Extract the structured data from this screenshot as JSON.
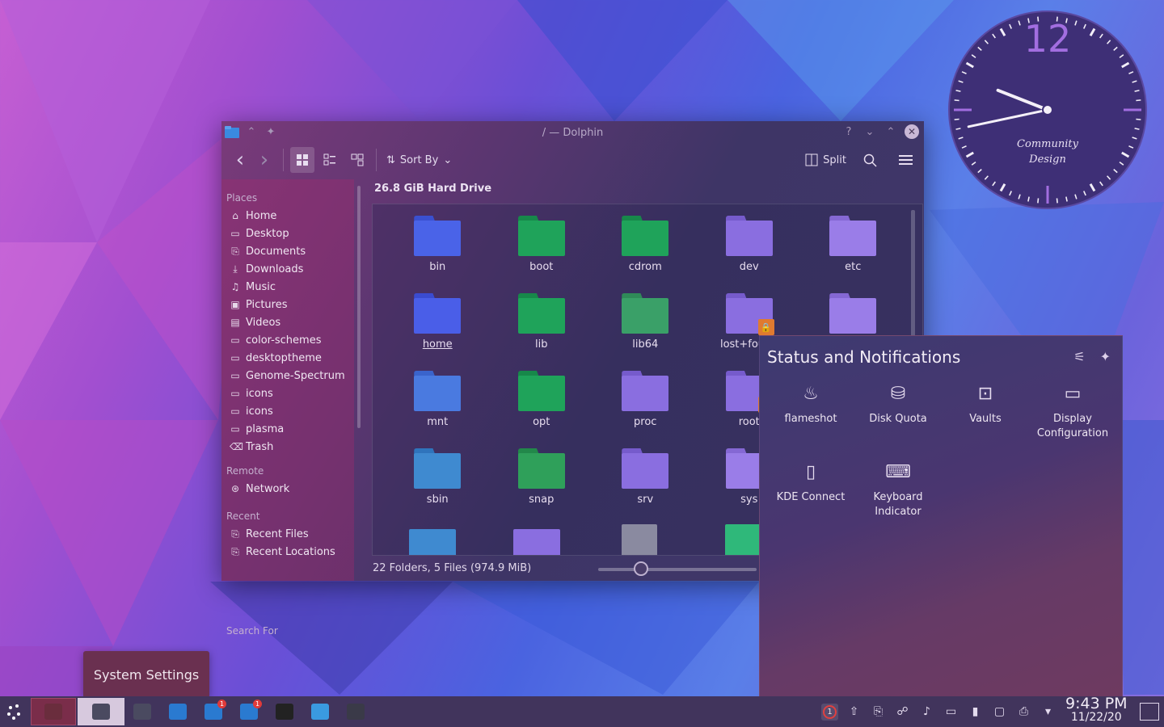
{
  "window": {
    "title": "/ — Dolphin",
    "help_glyph": "?",
    "min_glyph": "⌄",
    "max_glyph": "⌃",
    "close_glyph": "✕"
  },
  "toolbar": {
    "back_glyph": "‹",
    "forward_glyph": "›",
    "sort_by_label": "Sort By",
    "split_label": "Split"
  },
  "sidebar": {
    "places_heading": "Places",
    "places": [
      {
        "label": "Home",
        "icon": "home-icon",
        "glyph": "⌂"
      },
      {
        "label": "Desktop",
        "icon": "desktop-icon",
        "glyph": "▭"
      },
      {
        "label": "Documents",
        "icon": "documents-icon",
        "glyph": "⎘"
      },
      {
        "label": "Downloads",
        "icon": "downloads-icon",
        "glyph": "⤓"
      },
      {
        "label": "Music",
        "icon": "music-icon",
        "glyph": "♫"
      },
      {
        "label": "Pictures",
        "icon": "pictures-icon",
        "glyph": "▣"
      },
      {
        "label": "Videos",
        "icon": "videos-icon",
        "glyph": "▤"
      },
      {
        "label": "color-schemes",
        "icon": "folder-icon",
        "glyph": "▭"
      },
      {
        "label": "desktoptheme",
        "icon": "folder-icon",
        "glyph": "▭"
      },
      {
        "label": "Genome-Spectrum",
        "icon": "folder-icon",
        "glyph": "▭"
      },
      {
        "label": "icons",
        "icon": "folder-icon",
        "glyph": "▭"
      },
      {
        "label": "icons",
        "icon": "folder-icon",
        "glyph": "▭"
      },
      {
        "label": "plasma",
        "icon": "folder-icon",
        "glyph": "▭"
      },
      {
        "label": "Trash",
        "icon": "trash-icon",
        "glyph": "⌫"
      }
    ],
    "remote_heading": "Remote",
    "remote": [
      {
        "label": "Network",
        "icon": "network-icon",
        "glyph": "⊛"
      }
    ],
    "recent_heading": "Recent",
    "recent": [
      {
        "label": "Recent Files",
        "icon": "recent-files-icon",
        "glyph": "⎘"
      },
      {
        "label": "Recent Locations",
        "icon": "recent-locations-icon",
        "glyph": "⎘"
      }
    ],
    "search_heading": "Search For"
  },
  "main": {
    "header": "26.8 GiB Hard Drive",
    "status": "22 Folders, 5 Files (974.9 MiB)",
    "zoom_fraction": 0.27,
    "items": [
      {
        "name": "bin",
        "color": "#4a63e8",
        "accent": "#3a50d0"
      },
      {
        "name": "boot",
        "color": "#1fa35a",
        "accent": "#17884a"
      },
      {
        "name": "cdrom",
        "color": "#1fa35a",
        "accent": "#17884a"
      },
      {
        "name": "dev",
        "color": "#8a6ee0",
        "accent": "#765bcc"
      },
      {
        "name": "etc",
        "color": "#9a7de8",
        "accent": "#8568d4"
      },
      {
        "name": "home",
        "color": "#4a5ee8",
        "accent": "#3a4bd0",
        "selected": true
      },
      {
        "name": "lib",
        "color": "#1fa35a",
        "accent": "#17884a"
      },
      {
        "name": "lib64",
        "color": "#3aa068",
        "accent": "#2f8a58"
      },
      {
        "name": "lost+found",
        "color": "#8a6ee0",
        "accent": "#765bcc",
        "locked": true
      },
      {
        "name": "",
        "color": "#9a7de8",
        "accent": "#8568d4"
      },
      {
        "name": "mnt",
        "color": "#4a7ae0",
        "accent": "#3a64cc"
      },
      {
        "name": "opt",
        "color": "#1fa35a",
        "accent": "#17884a"
      },
      {
        "name": "proc",
        "color": "#8a6ee0",
        "accent": "#765bcc"
      },
      {
        "name": "root",
        "color": "#8a6ee0",
        "accent": "#765bcc",
        "locked": true
      },
      {
        "name": "",
        "color": "#8a6ee0",
        "accent": "#765bcc"
      },
      {
        "name": "sbin",
        "color": "#3f8ad0",
        "accent": "#2f74bc"
      },
      {
        "name": "snap",
        "color": "#2fa05a",
        "accent": "#22884a"
      },
      {
        "name": "srv",
        "color": "#8a6ee0",
        "accent": "#765bcc"
      },
      {
        "name": "sys",
        "color": "#9a7de8",
        "accent": "#8568d4"
      },
      {
        "name": "",
        "color": "#8a6ee0",
        "accent": "#765bcc"
      }
    ]
  },
  "notifications": {
    "title": "Status and Notifications",
    "applets": [
      {
        "label": "flameshot",
        "icon": "flameshot-icon",
        "glyph": "♨"
      },
      {
        "label": "Disk Quota",
        "icon": "disk-quota-icon",
        "glyph": "⛁"
      },
      {
        "label": "Vaults",
        "icon": "vaults-icon",
        "glyph": "⊡"
      },
      {
        "label": "Display Configuration",
        "icon": "display-icon",
        "glyph": "▭"
      },
      {
        "label": "KDE Connect",
        "icon": "kde-connect-icon",
        "glyph": "▯"
      },
      {
        "label": "Keyboard Indicator",
        "icon": "keyboard-icon",
        "glyph": "⌨"
      }
    ]
  },
  "tooltip": {
    "label": "System Settings"
  },
  "clock_widget": {
    "hour_numeral": "12",
    "brand_line1": "Community",
    "brand_line2": "Design",
    "time_hour": 9,
    "time_minute": 43
  },
  "taskbar": {
    "time": "9:43 PM",
    "date": "11/22/20",
    "tasks": [
      {
        "name": "task-terminal-active",
        "color": "#6a2d3d",
        "badge": ""
      },
      {
        "name": "task-system-settings",
        "color": "#4a4a60",
        "badge": ""
      },
      {
        "name": "task-settings-manager",
        "color": "#4a4a60",
        "badge": ""
      },
      {
        "name": "task-discover",
        "color": "#2a7ad0",
        "badge": ""
      },
      {
        "name": "task-dolphin-1",
        "color": "#2a7ad0",
        "badge": "1"
      },
      {
        "name": "task-dolphin-2",
        "color": "#2a7ad0",
        "badge": "1"
      },
      {
        "name": "task-inkscape",
        "color": "#222",
        "badge": ""
      },
      {
        "name": "task-browser",
        "color": "#3a9ae0",
        "badge": ""
      },
      {
        "name": "task-konsole",
        "color": "#3a3a48",
        "badge": ""
      }
    ],
    "tray_badge": "1"
  }
}
